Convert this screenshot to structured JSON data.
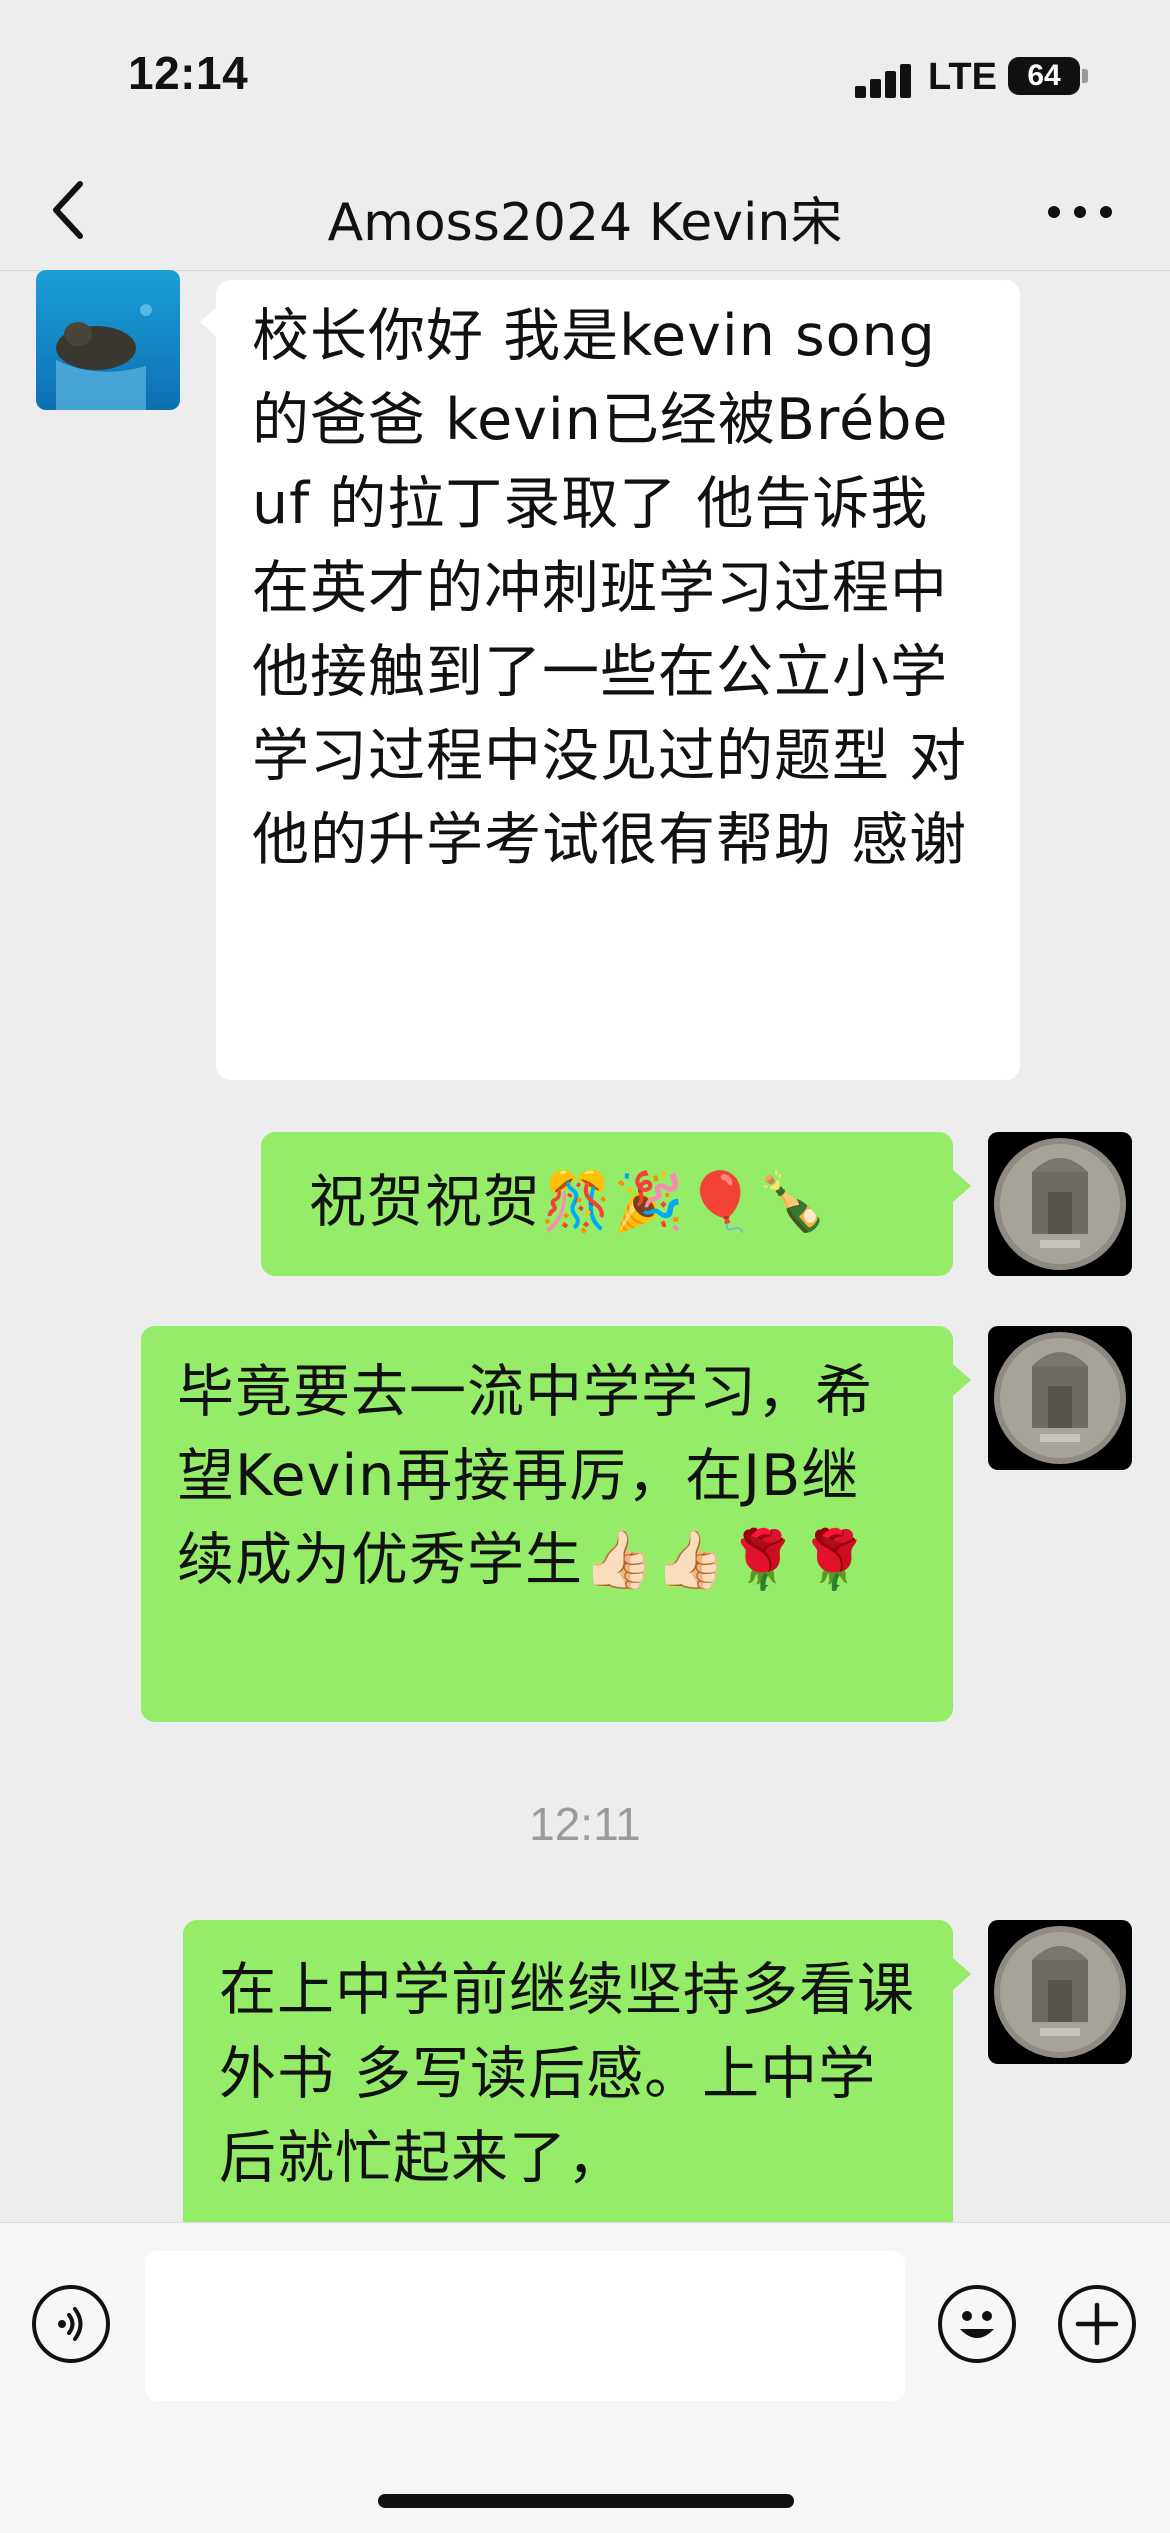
{
  "status_bar": {
    "time": "12:14",
    "network": "LTE",
    "battery": "64"
  },
  "nav": {
    "title": "Amoss2024 Kevin宋",
    "back_icon": "chevron-left-icon",
    "more_icon": "ellipsis-icon"
  },
  "messages": [
    {
      "side": "incoming",
      "text": "校长你好 我是kevin song的爸爸 kevin已经被Brébeuf 的拉丁录取了 他告诉我 在英才的冲刺班学习过程中 他接触到了一些在公立小学学习过程中没见过的题型 对他的升学考试很有帮助 感谢"
    },
    {
      "side": "outgoing",
      "text": "祝贺祝贺🎊🎉🎈🍾"
    },
    {
      "side": "outgoing",
      "text": "毕竟要去一流中学学习，希望Kevin再接再厉，在JB继续成为优秀学生👍🏻👍🏻🌹🌹"
    },
    {
      "side": "outgoing",
      "text": "在上中学前继续坚持多看课外书 多写读后感。上中学后就忙起来了，"
    }
  ],
  "timestamp": "12:11",
  "input_bar": {
    "voice_icon": "voice-icon",
    "emoji_icon": "emoji-icon",
    "plus_icon": "plus-icon",
    "input_value": ""
  },
  "colors": {
    "background": "#ededed",
    "outgoing_bubble": "#95ec69",
    "incoming_bubble": "#ffffff",
    "timestamp": "#9b9b9b"
  }
}
